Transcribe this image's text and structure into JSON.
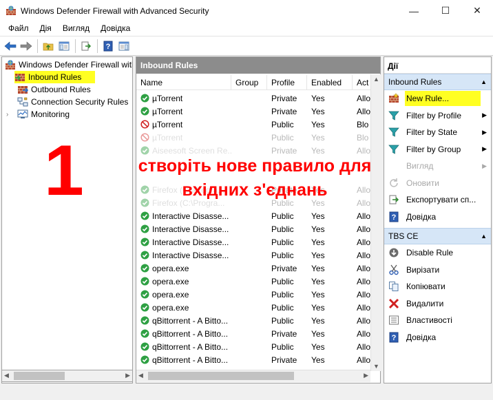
{
  "window": {
    "title": "Windows Defender Firewall with Advanced Security",
    "minimize": "—",
    "maximize": "☐",
    "close": "✕"
  },
  "menu": [
    "Файл",
    "Дія",
    "Вигляд",
    "Довідка"
  ],
  "tree": {
    "root": "Windows Defender Firewall witl",
    "items": [
      "Inbound Rules",
      "Outbound Rules",
      "Connection Security Rules",
      "Monitoring"
    ]
  },
  "center": {
    "title": "Inbound Rules",
    "columns": [
      "Name",
      "Group",
      "Profile",
      "Enabled",
      "Act"
    ],
    "rows": [
      {
        "name": "µTorrent",
        "profile": "Private",
        "enabled": "Yes",
        "action": "Allo",
        "status": "allow",
        "faded": false
      },
      {
        "name": "µTorrent",
        "profile": "Private",
        "enabled": "Yes",
        "action": "Allo",
        "status": "allow",
        "faded": false
      },
      {
        "name": "µTorrent",
        "profile": "Public",
        "enabled": "Yes",
        "action": "Blo",
        "status": "block",
        "faded": false
      },
      {
        "name": "µTorrent",
        "profile": "Public",
        "enabled": "Yes",
        "action": "Blo",
        "status": "block",
        "faded": true
      },
      {
        "name": "Aiseesoft Screen Re...",
        "profile": "Private",
        "enabled": "Yes",
        "action": "Allo",
        "status": "allow",
        "faded": true
      },
      {
        "name": "",
        "profile": "",
        "enabled": "",
        "action": "",
        "status": "none",
        "faded": true
      },
      {
        "name": "",
        "profile": "",
        "enabled": "",
        "action": "",
        "status": "none",
        "faded": true
      },
      {
        "name": "Firefox (C:\\Progra...",
        "profile": "Private",
        "enabled": "Yes",
        "action": "Allo",
        "status": "allow",
        "faded": true
      },
      {
        "name": "Firefox (C:\\Progra...",
        "profile": "Public",
        "enabled": "Yes",
        "action": "Allo",
        "status": "allow",
        "faded": true
      },
      {
        "name": "Interactive Disasse...",
        "profile": "Public",
        "enabled": "Yes",
        "action": "Allo",
        "status": "allow",
        "faded": false
      },
      {
        "name": "Interactive Disasse...",
        "profile": "Public",
        "enabled": "Yes",
        "action": "Allo",
        "status": "allow",
        "faded": false
      },
      {
        "name": "Interactive Disasse...",
        "profile": "Public",
        "enabled": "Yes",
        "action": "Allo",
        "status": "allow",
        "faded": false
      },
      {
        "name": "Interactive Disasse...",
        "profile": "Public",
        "enabled": "Yes",
        "action": "Allo",
        "status": "allow",
        "faded": false
      },
      {
        "name": "opera.exe",
        "profile": "Private",
        "enabled": "Yes",
        "action": "Allo",
        "status": "allow",
        "faded": false
      },
      {
        "name": "opera.exe",
        "profile": "Public",
        "enabled": "Yes",
        "action": "Allo",
        "status": "allow",
        "faded": false
      },
      {
        "name": "opera.exe",
        "profile": "Public",
        "enabled": "Yes",
        "action": "Allo",
        "status": "allow",
        "faded": false
      },
      {
        "name": "opera.exe",
        "profile": "Public",
        "enabled": "Yes",
        "action": "Allo",
        "status": "allow",
        "faded": false
      },
      {
        "name": "qBittorrent - A Bitto...",
        "profile": "Public",
        "enabled": "Yes",
        "action": "Allo",
        "status": "allow",
        "faded": false
      },
      {
        "name": "qBittorrent - A Bitto...",
        "profile": "Private",
        "enabled": "Yes",
        "action": "Allo",
        "status": "allow",
        "faded": false
      },
      {
        "name": "qBittorrent - A Bitto...",
        "profile": "Public",
        "enabled": "Yes",
        "action": "Allo",
        "status": "allow",
        "faded": false
      },
      {
        "name": "qBittorrent - A Bitto...",
        "profile": "Private",
        "enabled": "Yes",
        "action": "Allo",
        "status": "allow",
        "faded": false
      }
    ]
  },
  "actions": {
    "title": "Дії",
    "section1": "Inbound Rules",
    "items1": [
      {
        "label": "New Rule...",
        "icon": "new-rule-icon",
        "arrow": false,
        "disabled": false
      },
      {
        "label": "Filter by Profile",
        "icon": "filter-icon",
        "arrow": true,
        "disabled": false
      },
      {
        "label": "Filter by State",
        "icon": "filter-icon",
        "arrow": true,
        "disabled": false
      },
      {
        "label": "Filter by Group",
        "icon": "filter-icon",
        "arrow": true,
        "disabled": false
      },
      {
        "label": "Вигляд",
        "icon": "view-icon",
        "arrow": true,
        "disabled": true
      },
      {
        "label": "Оновити",
        "icon": "refresh-icon",
        "arrow": false,
        "disabled": true
      },
      {
        "label": "Експортувати сп...",
        "icon": "export-icon",
        "arrow": false,
        "disabled": false
      },
      {
        "label": "Довідка",
        "icon": "help-icon",
        "arrow": false,
        "disabled": false
      }
    ],
    "section2": "TBS CE",
    "items2": [
      {
        "label": "Disable Rule",
        "icon": "disable-icon"
      },
      {
        "label": "Вирізати",
        "icon": "cut-icon"
      },
      {
        "label": "Копіювати",
        "icon": "copy-icon"
      },
      {
        "label": "Видалити",
        "icon": "delete-icon"
      },
      {
        "label": "Властивості",
        "icon": "properties-icon"
      },
      {
        "label": "Довідка",
        "icon": "help-icon"
      }
    ]
  },
  "overlay": {
    "number": "1",
    "text_line1": "створіть нове правило для",
    "text_line2": "вхідних з'єднань"
  },
  "colors": {
    "highlight": "#ffff22",
    "overlay": "#ff0000",
    "allow": "#2ea043",
    "block": "#d02020"
  }
}
